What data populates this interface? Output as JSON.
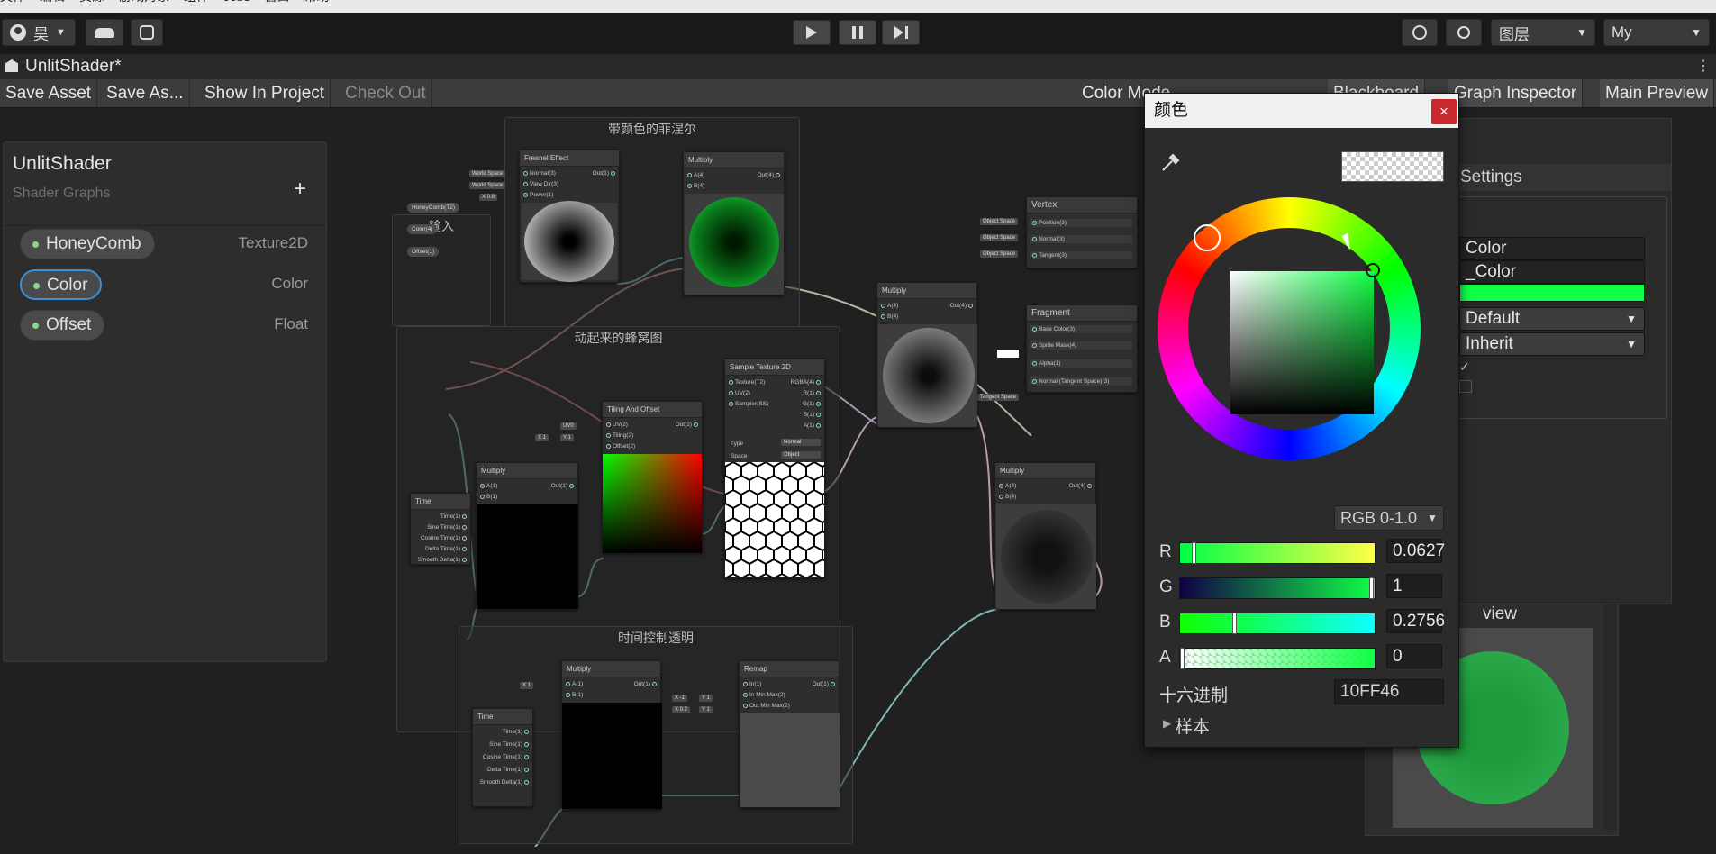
{
  "menu": [
    "文件",
    "编辑",
    "资源",
    "游戏对象",
    "组件",
    "Jobs",
    "窗口",
    "帮助"
  ],
  "toolbar": {
    "account_label": "昊",
    "layers_label": "图层",
    "layout_label": "My"
  },
  "window_tab": {
    "title": "UnlitShader*"
  },
  "graph_toolbar": {
    "save_asset": "Save Asset",
    "save_as": "Save As...",
    "show_in_project": "Show In Project",
    "check_out": "Check Out",
    "color_mode": "Color Mode",
    "blackboard": "Blackboard",
    "graph_inspector": "Graph Inspector",
    "main_preview": "Main Preview"
  },
  "blackboard": {
    "title": "UnlitShader",
    "subtitle": "Shader Graphs",
    "add": "+",
    "properties": [
      {
        "name": "HoneyComb",
        "type": "Texture2D"
      },
      {
        "name": "Color",
        "type": "Color"
      },
      {
        "name": "Offset",
        "type": "Float"
      }
    ]
  },
  "groups": {
    "fresnel": "带颜色的菲涅尔",
    "input": "输入",
    "honeycomb": "动起来的蜂窝图",
    "time_alpha": "时间控制透明"
  },
  "nodes": {
    "fresnel": {
      "title": "Fresnel Effect",
      "in": [
        "Normal(3)",
        "View Dir(3)",
        "Power(1)"
      ],
      "out": "Out(1)",
      "pills": [
        "World Space",
        "World Space",
        "X  0.8"
      ]
    },
    "multiply1": {
      "title": "Multiply",
      "in": [
        "A(4)",
        "B(4)"
      ],
      "out": "Out(4)"
    },
    "props": [
      "HoneyComb(T2)",
      "Color(4)",
      "Offset(1)"
    ],
    "vertex": {
      "title": "Vertex",
      "ports": [
        "Position(3)",
        "Normal(3)",
        "Tangent(3)"
      ],
      "pills": [
        "Object Space",
        "Object Space",
        "Object Space"
      ]
    },
    "fragment": {
      "title": "Fragment",
      "ports": [
        "Base Color(3)",
        "Sprite Mask(4)",
        "Alpha(1)",
        "Normal (Tangent Space)(3)"
      ],
      "pill": "Tangent Space"
    },
    "multiply_center": {
      "title": "Multiply",
      "in": [
        "A(4)",
        "B(4)"
      ],
      "out": "Out(4)"
    },
    "sample": {
      "title": "Sample Texture 2D",
      "in": [
        "Texture(T2)",
        "UV(2)",
        "Sampler(SS)"
      ],
      "out": [
        "RGBA(4)",
        "R(1)",
        "G(1)",
        "B(1)",
        "A(1)"
      ],
      "type_label": "Type",
      "type_value": "Normal",
      "space_label": "Space",
      "space_value": "Object"
    },
    "tiling": {
      "title": "Tiling And Offset",
      "in": [
        "UV(2)",
        "Tiling(2)",
        "Offset(2)"
      ],
      "out": "Out(2)",
      "pills": [
        "UV0",
        "X  1",
        "Y  1"
      ]
    },
    "multiply_time": {
      "title": "Multiply",
      "in": [
        "A(1)",
        "B(1)"
      ],
      "out": "Out(1)"
    },
    "time1": {
      "title": "Time",
      "out": [
        "Time(1)",
        "Sine Time(1)",
        "Cosine Time(1)",
        "Delta Time(1)",
        "Smooth Delta(1)"
      ]
    },
    "multiply_right": {
      "title": "Multiply",
      "in": [
        "A(4)",
        "B(4)"
      ],
      "out": "Out(4)"
    },
    "multiply_bottom": {
      "title": "Multiply",
      "in": [
        "A(1)",
        "B(1)"
      ],
      "out": "Out(1)",
      "pill": "X  1"
    },
    "time2": {
      "title": "Time",
      "out": [
        "Time(1)",
        "Sine Time(1)",
        "Cosine Time(1)",
        "Delta Time(1)",
        "Smooth Delta(1)"
      ]
    },
    "remap": {
      "title": "Remap",
      "in": [
        "In(1)",
        "In Min Max(2)",
        "Out Min Max(2)"
      ],
      "out": "Out(1)",
      "pills": [
        "X  -1",
        "Y  1",
        "X  0.2",
        "Y  1"
      ]
    }
  },
  "color_picker": {
    "title": "颜色",
    "close": "×",
    "mode": "RGB 0-1.0",
    "channels": [
      {
        "label": "R",
        "value": "0.0627",
        "level": 0.0627
      },
      {
        "label": "G",
        "value": "1",
        "level": 1
      },
      {
        "label": "B",
        "value": "0.2756",
        "level": 0.2756
      },
      {
        "label": "A",
        "value": "0",
        "level": 0
      }
    ],
    "hex_label": "十六进制",
    "hex_value": "10FF46",
    "swatches_label": "样本",
    "color_hex": "#10FF46"
  },
  "inspector": {
    "tab": "Settings",
    "name": "Color",
    "reference": "_Color",
    "mode": "Default",
    "precision": "Inherit",
    "color_hex": "#10FF46"
  },
  "main_preview": {
    "title": "Main Preview",
    "visible_title": "view"
  }
}
